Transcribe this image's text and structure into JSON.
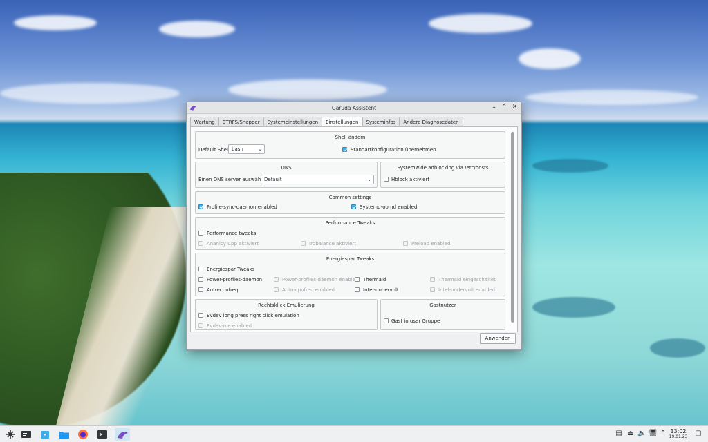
{
  "window": {
    "title": "Garuda Assistent",
    "controls": {
      "min": "⌄",
      "max": "⌃",
      "close": "✕"
    }
  },
  "tabs": [
    "Wartung",
    "BTRFS/Snapper",
    "Systemeinstellungen",
    "Einstellungen",
    "Systeminfos",
    "Andere Diagnosedaten"
  ],
  "active_tab": "Einstellungen",
  "shell": {
    "title": "Shell ändern",
    "default_label": "Default Shell:",
    "default_value": "bash",
    "standard_label": "Standartkonfiguration übernehmen",
    "standard_checked": true
  },
  "dns": {
    "title": "DNS",
    "select_label": "Einen DNS server auswählen",
    "select_value": "Default"
  },
  "adblock": {
    "title": "Systemwide adblocking via /etc/hosts",
    "hblock_label": "Hblock aktiviert"
  },
  "common": {
    "title": "Common settings",
    "psd_label": "Profile-sync-daemon enabled",
    "oomd_label": "Systemd-oomd enabled"
  },
  "performance": {
    "title": "Performance Tweaks",
    "tweaks_label": "Performance tweaks",
    "ananicy": "Ananicy Cpp aktiviert",
    "irqbalance": "Irqbalance aktiviert",
    "preload": "Preload enabled"
  },
  "energy": {
    "title": "Energiespar Tweaks",
    "tweaks_label": "Energiespar Tweaks",
    "ppd": "Power-profiles-daemon",
    "ppd_enabled": "Power-profiles-daemon enabled",
    "thermald": "Thermald",
    "thermald_on": "Thermald eingeschaltet",
    "autocpu": "Auto-cpufreq",
    "autocpu_enabled": "Auto-cpufreq enabled",
    "undervolt": "Intel-undervolt",
    "undervolt_enabled": "Intel-undervolt enabled"
  },
  "rightclick": {
    "title": "Rechtsklick Emulierung",
    "evdev": "Evdev long press right click emulation",
    "evdev_rce": "Evdev-rce enabled"
  },
  "guest": {
    "title": "Gastnutzer",
    "label": "Gast in user Gruppe"
  },
  "apply_label": "Anwenden",
  "clock": {
    "time": "13:02",
    "date": "19.01.23"
  },
  "colors": {
    "accent": "#3daee9",
    "panel": "#eff0f1"
  }
}
